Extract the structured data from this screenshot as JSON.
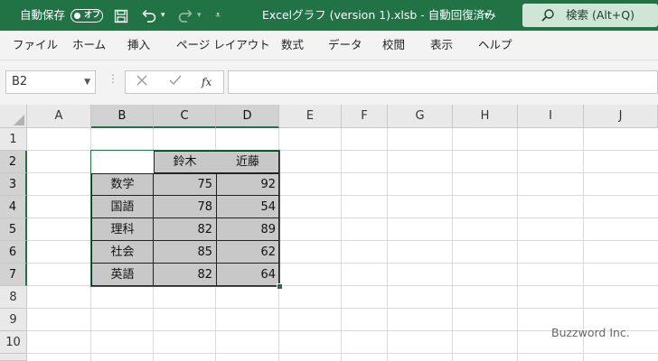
{
  "titlebar": {
    "autosave_label": "自動保存",
    "toggle_label": "オフ",
    "file_title": "Excelグラフ (version 1).xlsb  -  自動回復済み",
    "search_label": "検索 (Alt+Q)"
  },
  "menu": [
    "ファイル",
    "ホーム",
    "挿入",
    "ページ レイアウト",
    "数式",
    "データ",
    "校閲",
    "表示",
    "ヘルプ"
  ],
  "formula_bar": {
    "name_box": "B2",
    "fx": "fx",
    "formula": ""
  },
  "columns": [
    "A",
    "B",
    "C",
    "D",
    "E",
    "F",
    "G",
    "H",
    "I",
    "J"
  ],
  "rows": [
    "1",
    "2",
    "3",
    "4",
    "5",
    "6",
    "7",
    "8",
    "9",
    "10"
  ],
  "table": {
    "headers": [
      "",
      "鈴木",
      "近藤"
    ],
    "rows": [
      {
        "subject": "数学",
        "c": "75",
        "d": "92"
      },
      {
        "subject": "国語",
        "c": "78",
        "d": "54"
      },
      {
        "subject": "理科",
        "c": "82",
        "d": "89"
      },
      {
        "subject": "社会",
        "c": "85",
        "d": "62"
      },
      {
        "subject": "英語",
        "c": "82",
        "d": "64"
      }
    ]
  },
  "watermark": "Buzzword Inc.",
  "colors": {
    "excel_green": "#217346",
    "cell_shade": "#c8c8c8"
  }
}
